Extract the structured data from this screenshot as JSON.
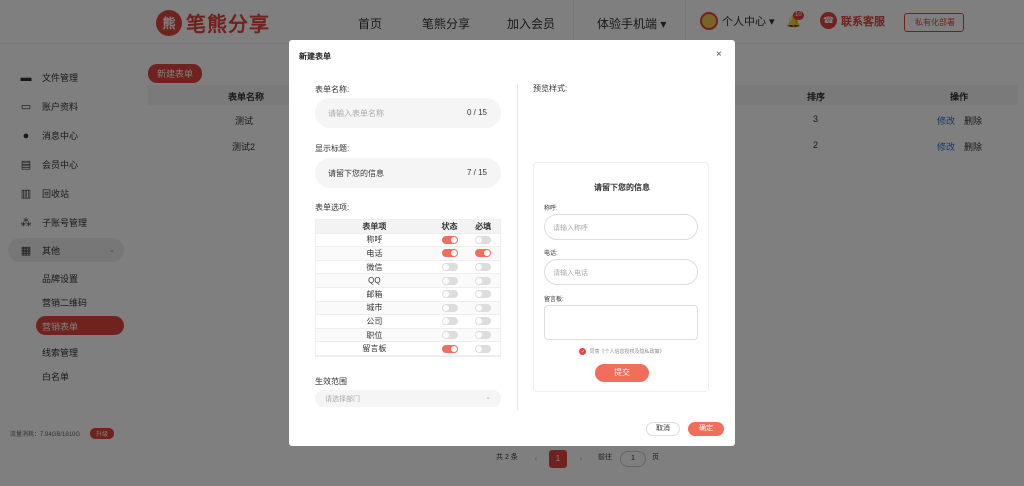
{
  "brand": {
    "name": "笔熊分享",
    "mark": "熊"
  },
  "nav": {
    "items": [
      "首页",
      "笔熊分享",
      "加入会员",
      "体验手机端 ▾"
    ],
    "user_label": "个人中心 ▾",
    "bell_count": "10",
    "customer_service": "联系客服",
    "private_deploy": "私有化部署"
  },
  "sidebar": {
    "items": [
      "文件管理",
      "账户资料",
      "消息中心",
      "会员中心",
      "回收站",
      "子账号管理",
      "其他"
    ],
    "sub_items": [
      "品牌设置",
      "营销二维码",
      "营销表单",
      "线索管理",
      "白名单"
    ],
    "storage_text": "流量消耗：7.94GB/1810G",
    "storage_btn": "升级"
  },
  "main": {
    "new_button": "新建表单",
    "columns": [
      "表单名称",
      "排序",
      "操作"
    ],
    "rows": [
      {
        "name": "测试",
        "order": "3",
        "edit": "修改",
        "delete": "删除"
      },
      {
        "name": "测试2",
        "order": "2",
        "edit": "修改",
        "delete": "删除"
      }
    ]
  },
  "pagination": {
    "total": "共 2 条",
    "prev": "‹",
    "current": "1",
    "next": "›",
    "goto_label": "前往",
    "goto_value": "1",
    "page_unit": "页"
  },
  "modal": {
    "title": "新建表单",
    "close": "×",
    "name_label": "表单名称:",
    "name_placeholder": "请输入表单名称",
    "name_count": "0 / 15",
    "title_label": "显示标题:",
    "title_value": "请留下您的信息",
    "title_count": "7 / 15",
    "options_label": "表单选项:",
    "options_header": {
      "item": "表单项",
      "status": "状态",
      "required": "必填"
    },
    "options": [
      {
        "name": "称呼",
        "status": true,
        "required": false
      },
      {
        "name": "电话",
        "status": true,
        "required": true
      },
      {
        "name": "微信",
        "status": false,
        "required": false
      },
      {
        "name": "QQ",
        "status": false,
        "required": false
      },
      {
        "name": "邮箱",
        "status": false,
        "required": false
      },
      {
        "name": "城市",
        "status": false,
        "required": false
      },
      {
        "name": "公司",
        "status": false,
        "required": false
      },
      {
        "name": "职位",
        "status": false,
        "required": false
      },
      {
        "name": "留言板",
        "status": true,
        "required": false
      }
    ],
    "scope_label": "生效范围",
    "scope_placeholder": "请选择部门",
    "preview_label": "预览样式:",
    "preview": {
      "title": "请留下您的信息",
      "field1_label": "称呼:",
      "field1_placeholder": "请输入称呼",
      "field2_label": "电话:",
      "field2_placeholder": "请输入电话",
      "field3_label": "留言板:",
      "agree_text": "同意《个人信息授权及隐私政策》",
      "submit": "提交"
    },
    "cancel": "取消",
    "ok": "确定"
  },
  "colors": {
    "brand": "#e0443e",
    "accent": "#f26d5b",
    "link": "#2a6fd6"
  }
}
